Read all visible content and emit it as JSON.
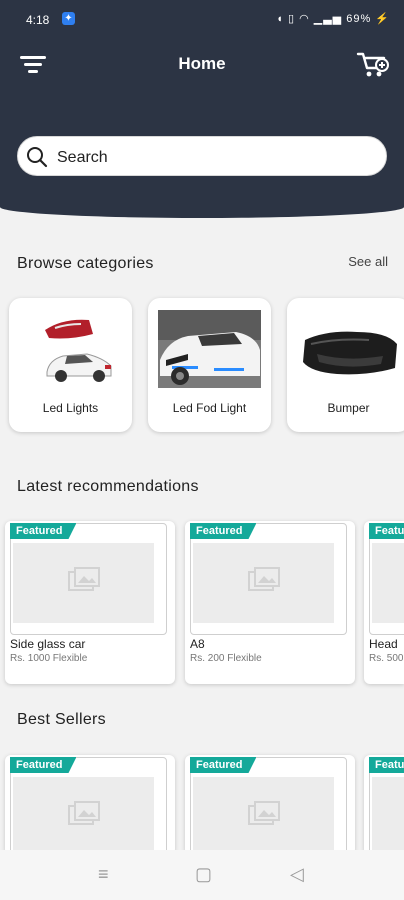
{
  "status_bar": {
    "time": "4:18",
    "battery": "69%"
  },
  "header": {
    "title": "Home"
  },
  "search": {
    "placeholder": "Search"
  },
  "categories": {
    "title": "Browse categories",
    "see_all": "See all",
    "items": [
      {
        "label": "Led Lights"
      },
      {
        "label": "Led Fod Light"
      },
      {
        "label": "Bumper"
      }
    ]
  },
  "latest": {
    "title": "Latest recommendations",
    "items": [
      {
        "badge": "Featured",
        "name": "Side glass car",
        "price": "Rs. 1000 Flexible"
      },
      {
        "badge": "Featured",
        "name": "A8",
        "price": "Rs. 200 Flexible"
      },
      {
        "badge": "Featured",
        "name": "Head",
        "price": "Rs. 500"
      }
    ]
  },
  "best_sellers": {
    "title": "Best Sellers",
    "items": [
      {
        "badge": "Featured"
      },
      {
        "badge": "Featured"
      },
      {
        "badge": "Featured"
      }
    ]
  },
  "icons": {
    "menu": "filter-menu-icon",
    "cart": "cart-icon",
    "search": "search-icon",
    "placeholder": "image-placeholder-icon"
  },
  "colors": {
    "header_bg": "#2c3444",
    "badge": "#14a99a",
    "background": "#f2f2f2"
  }
}
